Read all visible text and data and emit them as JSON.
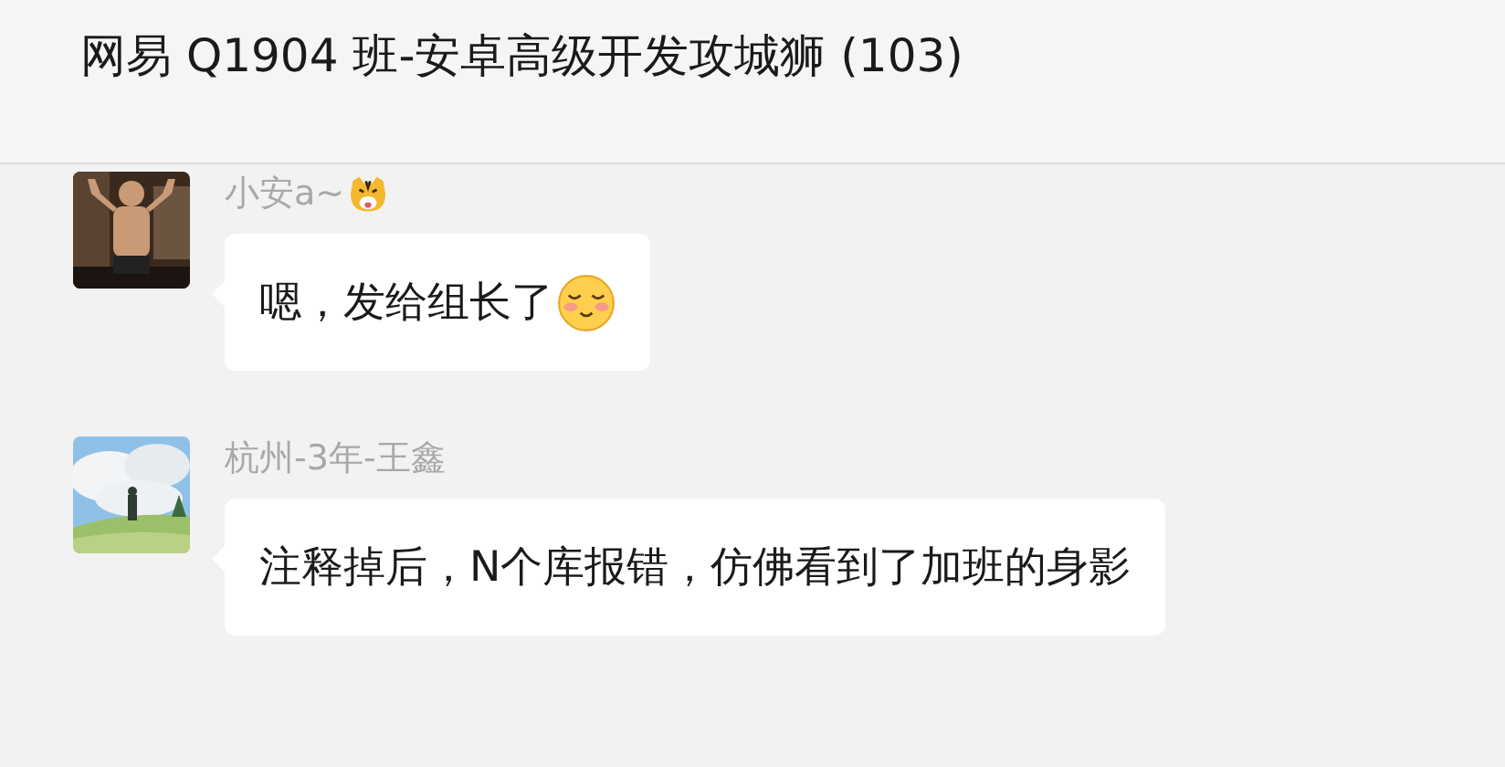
{
  "window": {
    "title": "网易 Q1904 班-安卓高级开发攻城狮 (103)"
  },
  "messages": [
    {
      "sender": "小安a~",
      "sender_emoji": true,
      "text": "嗯，发给组长了",
      "emoji": true
    },
    {
      "sender": "杭州-3年-王鑫",
      "sender_emoji": false,
      "text": "注释掉后，N个库报错，仿佛看到了加班的身影",
      "emoji": false
    }
  ]
}
